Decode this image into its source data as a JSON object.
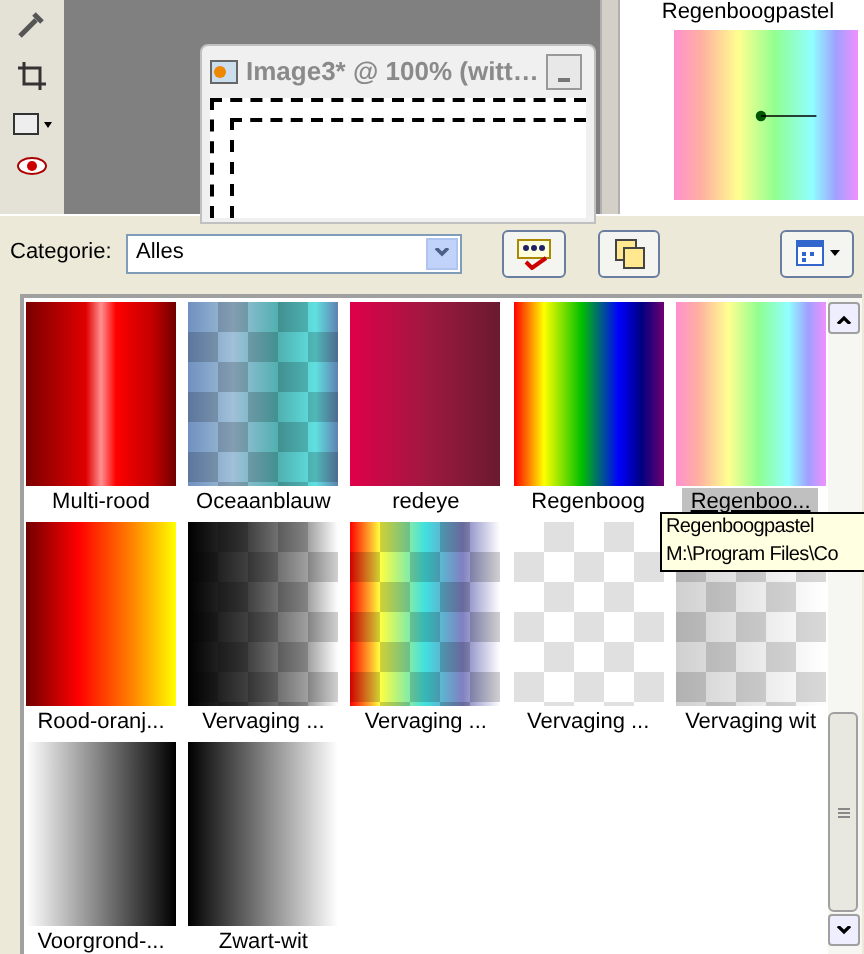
{
  "image_window": {
    "title": "Image3* @ 100% (witt…"
  },
  "preview_panel": {
    "title": "Regenboogpastel"
  },
  "toolbar": {
    "category_label": "Categorie:",
    "category_value": "Alles"
  },
  "gradients": [
    {
      "name": "Multi-rood",
      "selected": false
    },
    {
      "name": "Oceaanblauw",
      "selected": false
    },
    {
      "name": "redeye",
      "selected": false
    },
    {
      "name": "Regenboog",
      "selected": false
    },
    {
      "name": "Regenboo...",
      "selected": true
    },
    {
      "name": "Rood-oranj...",
      "selected": false
    },
    {
      "name": "Vervaging ...",
      "selected": false
    },
    {
      "name": "Vervaging ...",
      "selected": false
    },
    {
      "name": "Vervaging ...",
      "selected": false
    },
    {
      "name": "Vervaging wit",
      "selected": false
    },
    {
      "name": "Voorgrond-...",
      "selected": false
    },
    {
      "name": "Zwart-wit",
      "selected": false
    }
  ],
  "tooltip": {
    "lines": [
      "Regenboogpastel",
      "M:\\Program Files\\Co"
    ]
  }
}
